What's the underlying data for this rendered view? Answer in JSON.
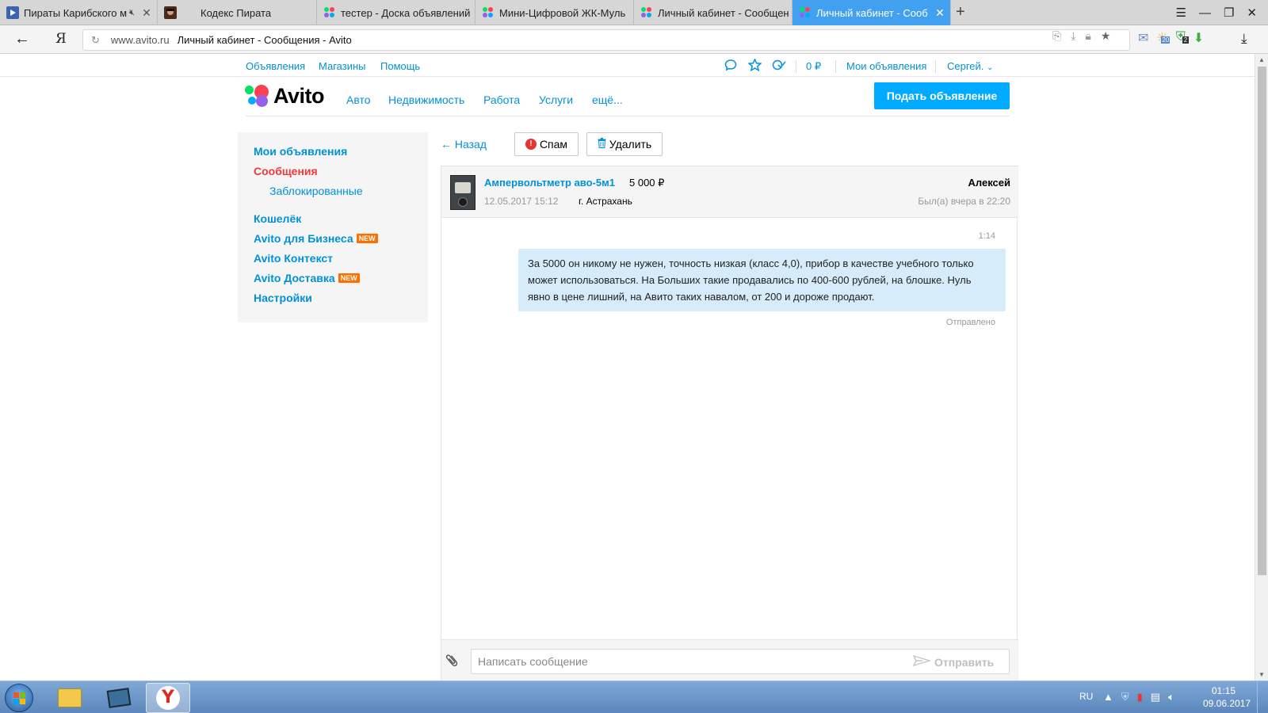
{
  "browser": {
    "tabs": [
      {
        "label": "Пираты Карибского м",
        "favicon": "video-icon",
        "active": false,
        "muted": true
      },
      {
        "label": "Кодекс Пирата",
        "favicon": "pirate-icon",
        "active": false
      },
      {
        "label": "тестер - Доска объявлений",
        "favicon": "avito-icon",
        "active": false
      },
      {
        "label": "Мини-Цифровой ЖК-Муль",
        "favicon": "avito-icon",
        "active": false
      },
      {
        "label": "Личный кабинет - Сообщен",
        "favicon": "avito-icon",
        "active": false
      },
      {
        "label": "Личный кабинет - Сооб",
        "favicon": "avito-icon",
        "active": true
      }
    ],
    "close_glyph": "✕",
    "new_tab": "+",
    "yandex_logo": "Я",
    "address": {
      "domain": "www.avito.ru",
      "title": "Личный кабинет - Сообщения - Avito"
    },
    "ext_badges": {
      "weather": "20",
      "protect": "2"
    }
  },
  "avito": {
    "topnav": {
      "ads": "Объявления",
      "shops": "Магазины",
      "help": "Помощь",
      "balance": "0 ₽",
      "my_ads": "Мои объявления",
      "user": "Сергей."
    },
    "logo": "Avito",
    "categories": [
      "Авто",
      "Недвижимость",
      "Работа",
      "Услуги",
      "ещё..."
    ],
    "post_ad": "Подать объявление",
    "sidebar": {
      "my_ads": "Мои объявления",
      "messages": "Сообщения",
      "blocked": "Заблокированные",
      "wallet": "Кошелёк",
      "business": "Avito для Бизнеса",
      "context": "Avito Контекст",
      "delivery": "Avito Доставка",
      "settings": "Настройки",
      "new_badge": "NEW"
    },
    "toolbar": {
      "back": "← Назад",
      "spam": "Спам",
      "delete": "Удалить"
    },
    "chat": {
      "item_title": "Ампервольтметр аво-5м1",
      "item_price": "5 000 ₽",
      "item_date": "12.05.2017 15:12",
      "item_city": "г. Астрахань",
      "seller": "Алексей",
      "seller_seen": "Был(а) вчера в 22:20",
      "messages": [
        {
          "time": "1:14",
          "text": "За 5000 он никому не нужен, точность низкая (класс 4,0), прибор в качестве учебного только может использоваться. На Больших такие продавались по 400-600 рублей, на блошке. Нуль явно в цене лишний, на Авито таких навалом, от 200 и дороже продают.",
          "status": "Отправлено"
        }
      ],
      "input_placeholder": "Написать сообщение",
      "send": "Отправить"
    }
  },
  "taskbar": {
    "lang": "RU",
    "time": "01:15",
    "date": "09.06.2017"
  },
  "colors": {
    "link": "#0091d9",
    "active_red": "#f5363b",
    "cta": "#00aaff",
    "bubble": "#d7ecfa",
    "active_tab": "#41a1f0"
  }
}
